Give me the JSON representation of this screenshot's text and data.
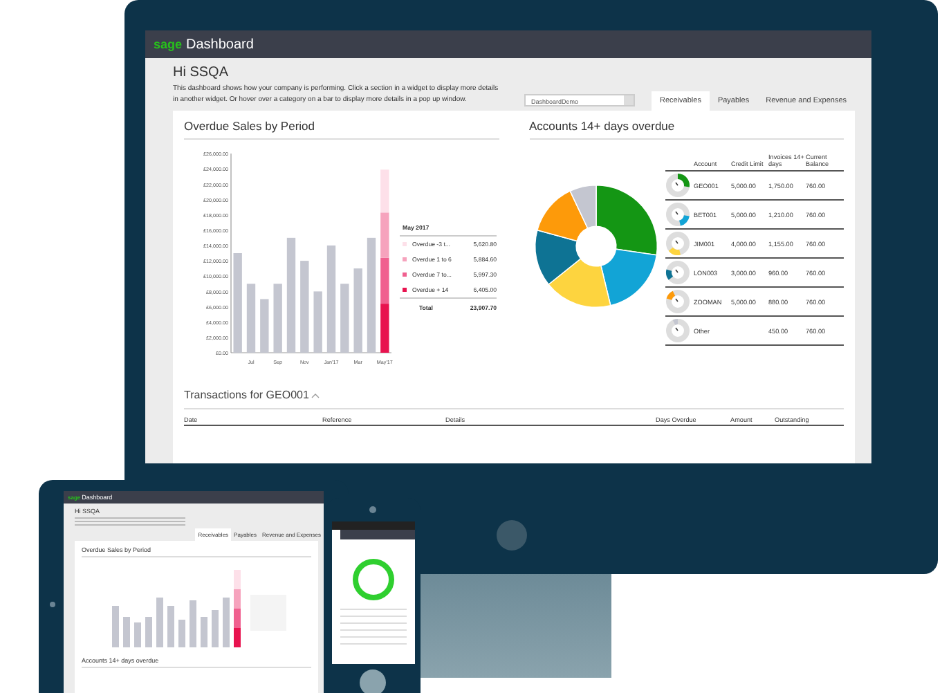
{
  "monitor": {
    "logo": "sage",
    "title": "Dashboard",
    "greeting": "Hi SSQA",
    "description": "This dashboard shows how your company is performing. Click a section in a widget to display more details in another widget. Or hover over a category on a bar to display more details in a pop up window.",
    "dropdown": {
      "value": "DashboardDemo"
    },
    "tabs": [
      {
        "label": "Receivables",
        "selected": true
      },
      {
        "label": "Payables",
        "selected": false
      },
      {
        "label": "Revenue and Expenses",
        "selected": false
      }
    ],
    "overdue_widget": {
      "title": "Overdue Sales by Period",
      "chart_data": {
        "type": "bar",
        "stacked": true,
        "categories": [
          null,
          "Jul",
          null,
          "Sep",
          null,
          "Nov",
          null,
          "Jan'17",
          null,
          "Mar",
          null,
          "May'17"
        ],
        "ylim": [
          0,
          26000
        ],
        "yticks": [
          {
            "value": 0,
            "label": "£0.00"
          },
          {
            "value": 2000,
            "label": "£2,000.00"
          },
          {
            "value": 4000,
            "label": "£4,000.00"
          },
          {
            "value": 6000,
            "label": "£6,000.00"
          },
          {
            "value": 8000,
            "label": "£8,000.00"
          },
          {
            "value": 10000,
            "label": "£10,000.00"
          },
          {
            "value": 12000,
            "label": "£12,000.00"
          },
          {
            "value": 14000,
            "label": "£14,000.00"
          },
          {
            "value": 16000,
            "label": "£16,000.00"
          },
          {
            "value": 18000,
            "label": "£18,000.00"
          },
          {
            "value": 20000,
            "label": "£20,000.00"
          },
          {
            "value": 22000,
            "label": "£22,000.00"
          },
          {
            "value": 24000,
            "label": "£24,000.00"
          },
          {
            "value": 26000,
            "label": "£26,000.00"
          }
        ],
        "series": [
          {
            "color": "#c4c6d0",
            "values": [
              13000,
              9000,
              7000,
              9000,
              15000,
              12000,
              8000,
              14000,
              9000,
              11000,
              15000,
              null
            ]
          },
          {
            "name": "Overdue + 14",
            "color": "#e8134f",
            "values": [
              null,
              null,
              null,
              null,
              null,
              null,
              null,
              null,
              null,
              null,
              null,
              6400
            ]
          },
          {
            "name": "Overdue 7 to...",
            "color": "#f0608f",
            "values": [
              null,
              null,
              null,
              null,
              null,
              null,
              null,
              null,
              null,
              null,
              null,
              6000
            ]
          },
          {
            "name": "Overdue 1 to 6",
            "color": "#f6a3bd",
            "values": [
              null,
              null,
              null,
              null,
              null,
              null,
              null,
              null,
              null,
              null,
              null,
              5900
            ]
          },
          {
            "name": "Overdue -3 t...",
            "color": "#fde0e9",
            "values": [
              null,
              null,
              null,
              null,
              null,
              null,
              null,
              null,
              null,
              null,
              null,
              5600
            ]
          }
        ]
      },
      "legend": {
        "title": "May 2017",
        "items": [
          {
            "value": "5,620.80"
          },
          {
            "value": "5,884.60"
          },
          {
            "value": "5,997.30"
          },
          {
            "value": "6,405.00"
          }
        ],
        "total_label": "Total",
        "total": "23,907.70"
      }
    },
    "accounts_widget": {
      "title": "Accounts 14+ days overdue",
      "chart_data": {
        "type": "donut",
        "categories": [
          "GEO001",
          "BET001",
          "JIM001",
          "LON003",
          "ZOOMAN",
          "Other"
        ],
        "values": [
          27.32,
          18.89,
          18.03,
          14.99,
          13.74,
          7.03
        ]
      },
      "columns": [
        "Account",
        "Credit Limit",
        "Invoices 14+ days",
        "Current Balance"
      ],
      "rows": [
        {
          "credit_limit": "5,000.00",
          "invoices": "1,750.00",
          "balance": "760.00",
          "color": "#149614"
        },
        {
          "credit_limit": "5,000.00",
          "invoices": "1,210.00",
          "balance": "760.00",
          "color": "#12a4d6"
        },
        {
          "credit_limit": "4,000.00",
          "invoices": "1,155.00",
          "balance": "760.00",
          "color": "#fdd43f"
        },
        {
          "credit_limit": "3,000.00",
          "invoices": "960.00",
          "balance": "760.00",
          "color": "#0e7394"
        },
        {
          "credit_limit": "5,000.00",
          "invoices": "880.00",
          "balance": "760.00",
          "color": "#fd9a0a"
        },
        {
          "invoices": "450.00",
          "balance": "760.00",
          "color": "#c4c6d0"
        }
      ]
    },
    "transactions": {
      "title": "Transactions for GEO001",
      "columns": [
        "Date",
        "Reference",
        "Details",
        "Days Overdue",
        "Amount",
        "Outstanding"
      ]
    }
  },
  "tablet": {
    "logo": "sage",
    "title": "Dashboard",
    "greeting": "Hi SSQA",
    "tabs": [
      {
        "label": "Receivables",
        "selected": true
      },
      {
        "label": "Payables",
        "selected": false
      },
      {
        "label": "Revenue and Expenses",
        "selected": false
      }
    ],
    "chart_title": "Overdue Sales by Period",
    "section_title": "Accounts 14+ days overdue"
  }
}
